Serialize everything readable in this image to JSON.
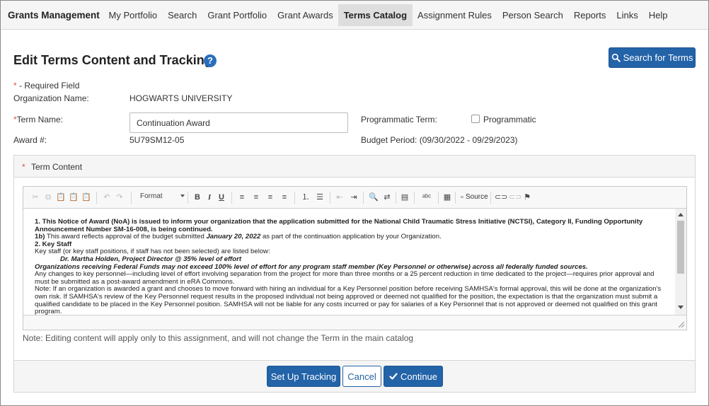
{
  "nav": {
    "brand": "Grants Management",
    "items": [
      "My Portfolio",
      "Search",
      "Grant Portfolio",
      "Grant Awards",
      "Terms Catalog",
      "Assignment Rules",
      "Person Search",
      "Reports",
      "Links",
      "Help"
    ],
    "active": "Terms Catalog"
  },
  "page": {
    "title": "Edit Terms Content and Tracking",
    "search_button": "Search for Terms"
  },
  "form": {
    "required_star": "*",
    "required_note": " - Required Field",
    "org_label": "Organization Name:",
    "org_value": "HOGWARTS UNIVERSITY",
    "term_name_label": "Term Name:",
    "term_name_value": "Continuation Award",
    "programmatic_label": "Programmatic Term:",
    "programmatic_checkbox_label": "Programmatic",
    "programmatic_checked": false,
    "award_label": "Award #:",
    "award_value": "5U79SM12-05",
    "budget_period": "Budget Period: (09/30/2022 - 09/29/2023)"
  },
  "term_content": {
    "heading": "Term Content",
    "toolbar": {
      "format_label": "Format",
      "source_label": "Source"
    },
    "content": {
      "p1": "1. This Notice of Award (NoA) is issued to inform your organization that the application submitted for the National Child Traumatic Stress Initiative (NCTSI), Category II, Funding Opportunity Announcement Number SM-16-008, is being continued.",
      "p2_lead": "1b)",
      "p2_text": " This award reflects approval of the budget submitted ",
      "p2_date": "January 20, 2022",
      "p2_tail": " as part of the continuation application by your Organization.",
      "p3": "2. Key Staff",
      "p4": "Key staff (or key staff positions, if staff has not been selected) are listed below:",
      "p5": "Dr. Martha Holden, Project Director @ 35% level of effort",
      "p6": "Organizations receiving Federal Funds may not exceed 100% level of effort for any program staff member (Key Personnel or otherwise) across all federally funded sources.",
      "p7": "Any changes to key personnel—including level of effort involving separation from the project for more than three months or a 25 percent reduction in time dedicated to the project—requires prior approval and must be submitted as a post-award amendment in eRA Commons.",
      "p8": "Note: If an organization is awarded a grant and chooses to move forward with hiring an individual for a Key Personnel position before receiving SAMHSA's formal approval, this will be done at the organization's own risk. If SAMHSA's review of the Key Personnel request results in the proposed individual not being approved or deemed not qualified for the position, the expectation is that the organization must submit a qualified candidate to be placed in the Key Personnel position. SAMHSA will not be liable for any costs incurred or pay for salaries of a Key Personnel that is not approved or deemed not qualified on this grant program."
    },
    "note": "Note: Editing content will apply only to this assignment, and will not change the Term in the main catalog"
  },
  "footer": {
    "setup_tracking": "Set Up Tracking",
    "cancel": "Cancel",
    "continue": "Continue"
  },
  "colors": {
    "primary": "#2363a8",
    "required": "#d9534f",
    "nav_bg": "#f5f5f5",
    "nav_active": "#dedede"
  }
}
